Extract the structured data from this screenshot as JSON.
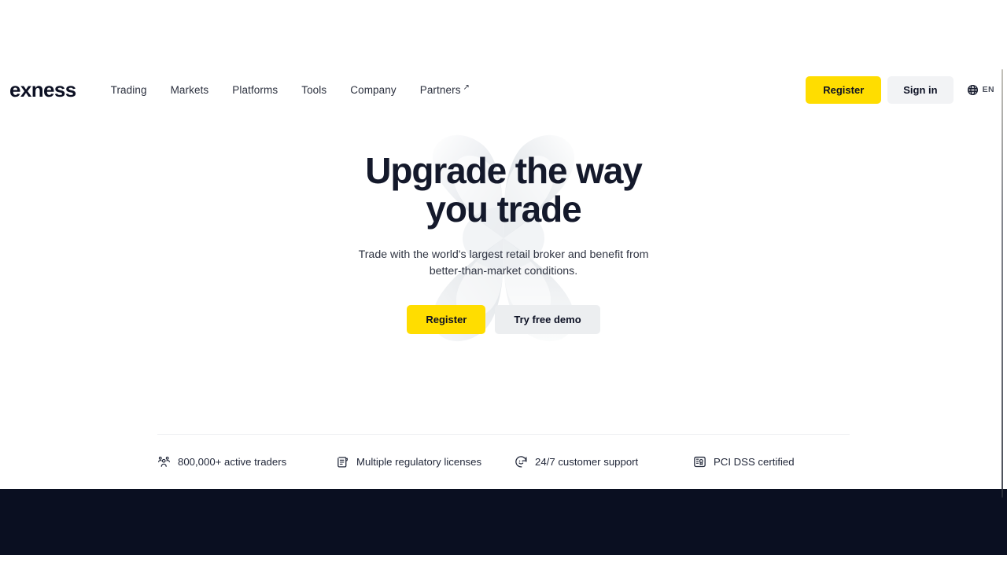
{
  "brand": {
    "logo_text": "exness",
    "accent_yellow": "#ffdd00",
    "dark_navy": "#0a0f21",
    "text_dark": "#14192b"
  },
  "header": {
    "nav": [
      {
        "label": "Trading",
        "external": false
      },
      {
        "label": "Markets",
        "external": false
      },
      {
        "label": "Platforms",
        "external": false
      },
      {
        "label": "Tools",
        "external": false
      },
      {
        "label": "Company",
        "external": false
      },
      {
        "label": "Partners",
        "external": true,
        "arrow": "↗"
      }
    ],
    "register_label": "Register",
    "signin_label": "Sign in",
    "language": {
      "icon": "globe-icon",
      "code": "EN"
    }
  },
  "hero": {
    "title_line1": "Upgrade the way",
    "title_line2": "you trade",
    "subtitle": "Trade with the world's largest retail broker and benefit from better-than-market conditions.",
    "primary_cta": "Register",
    "secondary_cta": "Try free demo",
    "background_art": "exness-ribbon-knot-3d"
  },
  "features": [
    {
      "icon": "people-group-icon",
      "label": "800,000+ active traders"
    },
    {
      "icon": "license-scroll-icon",
      "label": "Multiple regulatory licenses"
    },
    {
      "icon": "support-smiley-clock-icon",
      "label": "24/7 customer support"
    },
    {
      "icon": "pci-certificate-icon",
      "label": "PCI DSS certified"
    }
  ]
}
